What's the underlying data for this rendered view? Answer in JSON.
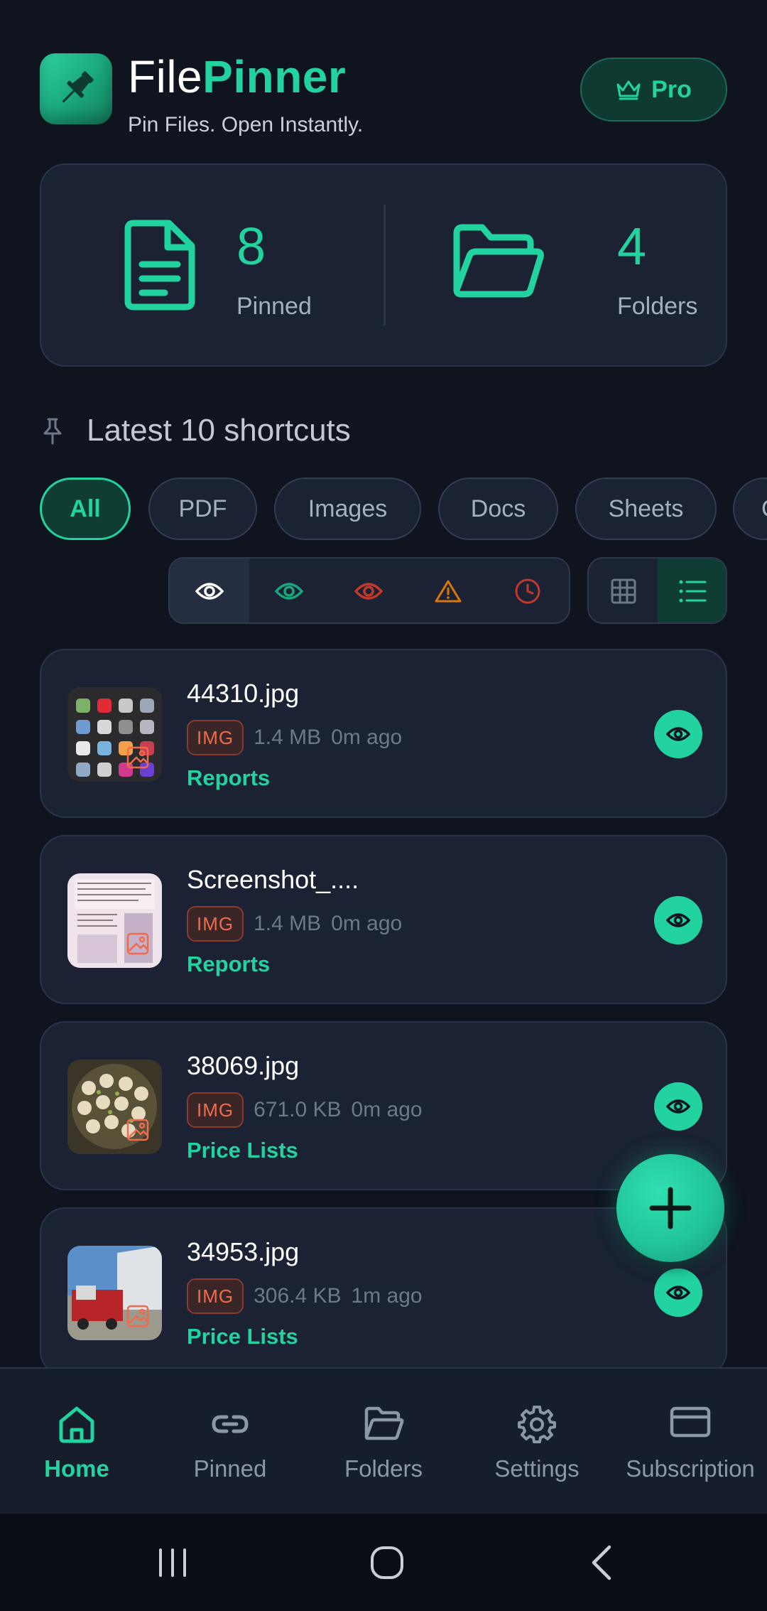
{
  "app": {
    "title_part1": "File",
    "title_part2": "Pinner",
    "tagline": "Pin Files. Open Instantly.",
    "pro_label": "Pro"
  },
  "stats": {
    "pinned_count": "8",
    "pinned_label": "Pinned",
    "folders_count": "4",
    "folders_label": "Folders"
  },
  "section": {
    "title": "Latest 10 shortcuts"
  },
  "filters": {
    "chips": [
      "All",
      "PDF",
      "Images",
      "Docs",
      "Sheets",
      "C"
    ],
    "active": "All"
  },
  "status_filters": [
    {
      "icon": "eye-icon",
      "color": "#ffffff",
      "active": true
    },
    {
      "icon": "eye-icon",
      "color": "#1aa67d",
      "active": false
    },
    {
      "icon": "eye-icon",
      "color": "#c0392b",
      "active": false
    },
    {
      "icon": "warning-icon",
      "color": "#d97706",
      "active": false
    },
    {
      "icon": "clock-icon",
      "color": "#c0392b",
      "active": false
    }
  ],
  "view_modes": [
    {
      "icon": "grid-icon",
      "active": false
    },
    {
      "icon": "list-icon",
      "active": true
    }
  ],
  "files": [
    {
      "name": "44310.jpg",
      "type": "IMG",
      "size": "1.4 MB",
      "time": "0m ago",
      "folder": "Reports"
    },
    {
      "name": "Screenshot_....",
      "type": "IMG",
      "size": "1.4 MB",
      "time": "0m ago",
      "folder": "Reports"
    },
    {
      "name": "38069.jpg",
      "type": "IMG",
      "size": "671.0 KB",
      "time": "0m ago",
      "folder": "Price Lists"
    },
    {
      "name": "34953.jpg",
      "type": "IMG",
      "size": "306.4 KB",
      "time": "1m ago",
      "folder": "Price Lists"
    }
  ],
  "nav": {
    "items": [
      {
        "label": "Home",
        "icon": "home-icon",
        "active": true
      },
      {
        "label": "Pinned",
        "icon": "link-icon",
        "active": false
      },
      {
        "label": "Folders",
        "icon": "folder-open-icon",
        "active": false
      },
      {
        "label": "Settings",
        "icon": "gear-icon",
        "active": false
      },
      {
        "label": "Subscription",
        "icon": "card-icon",
        "active": false
      }
    ]
  },
  "colors": {
    "accent": "#22d3a0",
    "background": "#0f141f",
    "card": "#1a2233",
    "badge_text": "#f06a4e"
  }
}
